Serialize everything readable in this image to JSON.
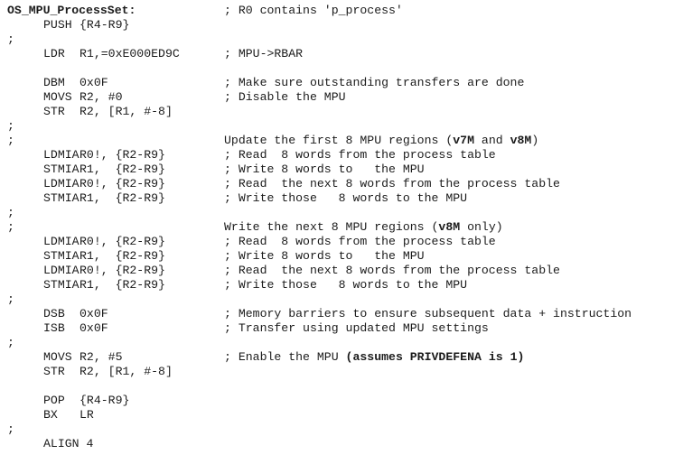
{
  "document": {
    "kind": "assembly-code-listing",
    "language": "ARM assembly",
    "background_color": "#ffffff",
    "text_color": "#1b1b1b",
    "comment_marker": ";"
  },
  "code": {
    "lines": [
      {
        "id": "l01",
        "label": "OS_MPU_ProcessSet:",
        "label_bold": true,
        "mnemonic": "",
        "operands": "",
        "comment": "; R0 contains 'p_process'"
      },
      {
        "id": "l02",
        "label": "",
        "mnemonic": "PUSH",
        "operands": "{R4-R9}",
        "comment": ""
      },
      {
        "id": "l03",
        "label": ";",
        "mnemonic": "",
        "operands": "",
        "comment": ""
      },
      {
        "id": "l04",
        "label": "",
        "mnemonic": "LDR",
        "operands": "R1,=0xE000ED9C",
        "comment": "; MPU->RBAR"
      },
      {
        "id": "l05",
        "label": "",
        "mnemonic": "",
        "operands": "",
        "comment": ""
      },
      {
        "id": "l06",
        "label": "",
        "mnemonic": "DBM",
        "operands": "0x0F",
        "comment": "; Make sure outstanding transfers are done"
      },
      {
        "id": "l07",
        "label": "",
        "mnemonic": "MOVS",
        "operands": "R2, #0",
        "comment": "; Disable the MPU"
      },
      {
        "id": "l08",
        "label": "",
        "mnemonic": "STR",
        "operands": "R2, [R1, #-8]",
        "comment": ""
      },
      {
        "id": "l09",
        "label": ";",
        "mnemonic": "",
        "operands": "",
        "comment": ""
      },
      {
        "id": "l10",
        "label": ";",
        "mnemonic": "",
        "operands": "",
        "comment": "Update the first 8 MPU regions (v7M and v8M)",
        "comment_no_marker": true,
        "comment_parts": [
          {
            "text": "Update the first 8 MPU regions (",
            "bold": false
          },
          {
            "text": "v7M",
            "bold": true
          },
          {
            "text": " and ",
            "bold": false
          },
          {
            "text": "v8M",
            "bold": true
          },
          {
            "text": ")",
            "bold": false
          }
        ]
      },
      {
        "id": "l11",
        "label": "",
        "mnemonic": "LDMIA",
        "operands": "R0!, {R2-R9}",
        "comment": "; Read  8 words from the process table"
      },
      {
        "id": "l12",
        "label": "",
        "mnemonic": "STMIA",
        "operands": "R1,  {R2-R9}",
        "comment": "; Write 8 words to   the MPU"
      },
      {
        "id": "l13",
        "label": "",
        "mnemonic": "LDMIA",
        "operands": "R0!, {R2-R9}",
        "comment": "; Read  the next 8 words from the process table"
      },
      {
        "id": "l14",
        "label": "",
        "mnemonic": "STMIA",
        "operands": "R1,  {R2-R9}",
        "comment": "; Write those   8 words to the MPU"
      },
      {
        "id": "l15",
        "label": ";",
        "mnemonic": "",
        "operands": "",
        "comment": ""
      },
      {
        "id": "l16",
        "label": ";",
        "mnemonic": "",
        "operands": "",
        "comment": "Write the next 8 MPU regions (v8M only)",
        "comment_no_marker": true,
        "comment_parts": [
          {
            "text": "Write the next 8 MPU regions (",
            "bold": false
          },
          {
            "text": "v8M",
            "bold": true
          },
          {
            "text": " only)",
            "bold": false
          }
        ]
      },
      {
        "id": "l17",
        "label": "",
        "mnemonic": "LDMIA",
        "operands": "R0!, {R2-R9}",
        "comment": "; Read  8 words from the process table"
      },
      {
        "id": "l18",
        "label": "",
        "mnemonic": "STMIA",
        "operands": "R1,  {R2-R9}",
        "comment": "; Write 8 words to   the MPU"
      },
      {
        "id": "l19",
        "label": "",
        "mnemonic": "LDMIA",
        "operands": "R0!, {R2-R9}",
        "comment": "; Read  the next 8 words from the process table"
      },
      {
        "id": "l20",
        "label": "",
        "mnemonic": "STMIA",
        "operands": "R1,  {R2-R9}",
        "comment": "; Write those   8 words to the MPU"
      },
      {
        "id": "l21",
        "label": ";",
        "mnemonic": "",
        "operands": "",
        "comment": ""
      },
      {
        "id": "l22",
        "label": "",
        "mnemonic": "DSB",
        "operands": "0x0F",
        "comment": "; Memory barriers to ensure subsequent data + instruction"
      },
      {
        "id": "l23",
        "label": "",
        "mnemonic": "ISB",
        "operands": "0x0F",
        "comment": "; Transfer using updated MPU settings"
      },
      {
        "id": "l24",
        "label": ";",
        "mnemonic": "",
        "operands": "",
        "comment": ""
      },
      {
        "id": "l25",
        "label": "",
        "mnemonic": "MOVS",
        "operands": "R2, #5",
        "comment": "; Enable the MPU (assumes PRIVDEFENA is 1)",
        "comment_parts": [
          {
            "text": "; Enable the MPU ",
            "bold": false
          },
          {
            "text": "(assumes PRIVDEFENA is 1)",
            "bold": true
          }
        ]
      },
      {
        "id": "l26",
        "label": "",
        "mnemonic": "STR",
        "operands": "R2, [R1, #-8]",
        "comment": ""
      },
      {
        "id": "l27",
        "label": "",
        "mnemonic": "",
        "operands": "",
        "comment": ""
      },
      {
        "id": "l28",
        "label": "",
        "mnemonic": "POP",
        "operands": "{R4-R9}",
        "comment": ""
      },
      {
        "id": "l29",
        "label": "",
        "mnemonic": "BX",
        "operands": "LR",
        "comment": ""
      },
      {
        "id": "l30",
        "label": ";",
        "mnemonic": "",
        "operands": "",
        "comment": ""
      },
      {
        "id": "l31",
        "label": "",
        "mnemonic": "ALIGN",
        "operands": "4",
        "comment": "",
        "mnemonic_with_operand_inline": "ALIGN 4"
      }
    ]
  }
}
